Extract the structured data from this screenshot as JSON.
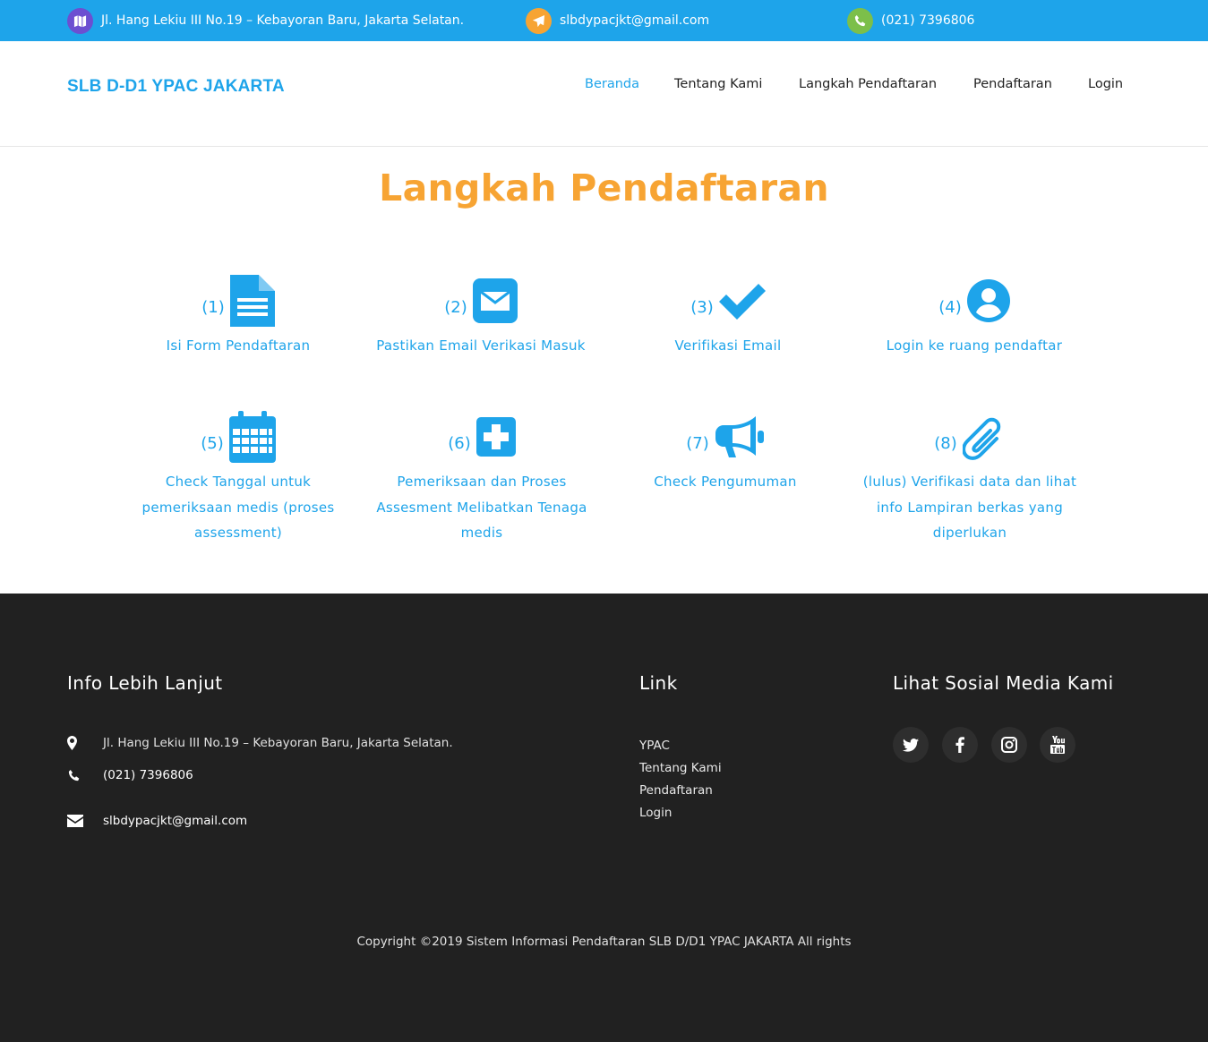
{
  "topbar": {
    "address": "Jl. Hang Lekiu III No.19 – Kebayoran Baru, Jakarta Selatan.",
    "email": "slbdypacjkt@gmail.com",
    "phone": "(021) 7396806",
    "colors": {
      "background": "#1ea4ea",
      "address_icon_bg": "#6c4fd1",
      "email_icon_bg": "#f7a433",
      "phone_icon_bg": "#7cbf4a"
    },
    "icons": {
      "address": "map-icon",
      "email": "paper-plane-icon",
      "phone": "phone-icon"
    }
  },
  "header": {
    "brand": "SLB D-D1 YPAC JAKARTA",
    "nav": [
      "Beranda",
      "Tentang Kami",
      "Langkah Pendaftaran",
      "Pendaftaran",
      "Login"
    ],
    "active_nav": "Beranda"
  },
  "main": {
    "title": "Langkah Pendaftaran",
    "steps": [
      {
        "num": "(1)",
        "label": "Isi Form Pendaftaran",
        "icon": "document-icon"
      },
      {
        "num": "(2)",
        "label": "Pastikan Email Verikasi Masuk",
        "icon": "envelope-icon"
      },
      {
        "num": "(3)",
        "label": "Verifikasi Email",
        "icon": "check-icon"
      },
      {
        "num": "(4)",
        "label": "Login ke ruang pendaftar",
        "icon": "user-circle-icon"
      },
      {
        "num": "(5)",
        "label": "Check Tanggal untuk pemeriksaan medis (proses assessment)",
        "icon": "calendar-icon"
      },
      {
        "num": "(6)",
        "label": "Pemeriksaan dan Proses Assesment Melibatkan Tenaga medis",
        "icon": "medical-plus-icon"
      },
      {
        "num": "(7)",
        "label": "Check Pengumuman",
        "icon": "megaphone-icon"
      },
      {
        "num": "(8)",
        "label": "(lulus) Verifikasi data dan lihat info Lampiran berkas yang diperlukan",
        "icon": "paperclip-icon"
      }
    ],
    "colors": {
      "title": "#f7a433",
      "steps": "#1ea4ea"
    }
  },
  "footer": {
    "info_heading": "Info Lebih Lanjut",
    "address": "Jl. Hang Lekiu III No.19 – Kebayoran Baru, Jakarta Selatan.",
    "phone": "(021) 7396806",
    "email": "slbdypacjkt@gmail.com",
    "link_heading": "Link",
    "links": [
      "YPAC",
      "Tentang Kami",
      "Pendaftaran",
      "Login"
    ],
    "social_heading": "Lihat Sosial Media Kami",
    "social": [
      "twitter-icon",
      "facebook-icon",
      "instagram-icon",
      "youtube-icon"
    ],
    "copyright": "Copyright ©2019 Sistem Informasi Pendaftaran SLB D/D1 YPAC JAKARTA All rights",
    "colors": {
      "background": "#212121"
    }
  }
}
